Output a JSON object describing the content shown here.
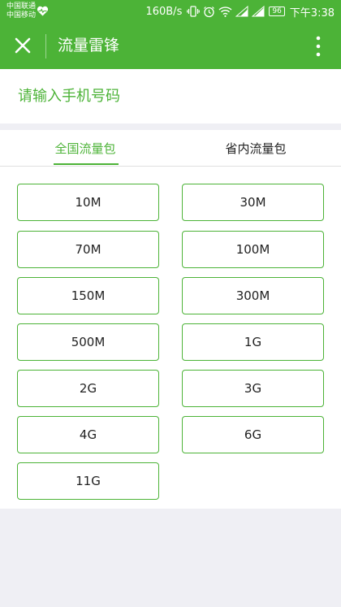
{
  "status_bar": {
    "carrier_1": "中国联通",
    "carrier_2": "中国移动",
    "net_speed": "160B/s",
    "battery": "96",
    "time": "下午3:38"
  },
  "header": {
    "title": "流量雷锋",
    "background_color": "#4cb337"
  },
  "phone": {
    "placeholder": "请输入手机号码",
    "value": ""
  },
  "tabs": [
    {
      "label": "全国流量包",
      "active": true
    },
    {
      "label": "省内流量包",
      "active": false
    }
  ],
  "packages": [
    "10M",
    "30M",
    "70M",
    "100M",
    "150M",
    "300M",
    "500M",
    "1G",
    "2G",
    "3G",
    "4G",
    "6G",
    "11G"
  ],
  "colors": {
    "accent": "#4cb337",
    "page_background": "#efeff4"
  }
}
